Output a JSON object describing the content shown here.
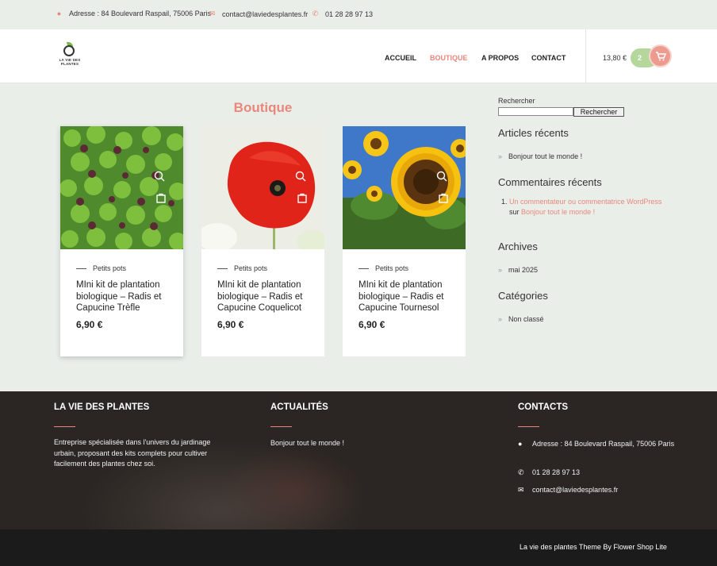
{
  "topbar": {
    "address": "Adresse : 84 Boulevard Raspail, 75006 Paris",
    "email": "contact@laviedesplantes.fr",
    "phone": "01 28 28 97 13",
    "icons": [
      "map-marker-icon",
      "envelope-icon",
      "phone-icon"
    ]
  },
  "logo": {
    "line1": "LA VIE DES",
    "line2": "PLANTES"
  },
  "nav": [
    {
      "label": "ACCUEIL",
      "active": false
    },
    {
      "label": "BOUTIQUE",
      "active": true
    },
    {
      "label": "A PROPOS",
      "active": false
    },
    {
      "label": "CONTACT",
      "active": false
    }
  ],
  "cart": {
    "total": "13,80 €",
    "count": "2",
    "icon": "cart-icon"
  },
  "page": {
    "title": "Boutique"
  },
  "products": [
    {
      "category": "Petits pots",
      "title": "MIni kit de plantation biologique – Radis et Capucine Trèfle",
      "price": "6,90 €",
      "image": "clover-leaves"
    },
    {
      "category": "Petits pots",
      "title": "MIni kit de plantation biologique – Radis et Capucine Coquelicot",
      "price": "6,90 €",
      "image": "red-poppy"
    },
    {
      "category": "Petits pots",
      "title": "MIni kit de plantation biologique – Radis et Capucine Tournesol",
      "price": "6,90 €",
      "image": "sunflower"
    }
  ],
  "sidebar": {
    "search_label": "Rechercher",
    "search_value": "",
    "search_button": "Rechercher",
    "recent_posts_title": "Articles récents",
    "recent_posts": [
      "Bonjour tout le monde !"
    ],
    "recent_comments_title": "Commentaires récents",
    "comment_author": "Un commentateur ou commentatrice WordPress",
    "comment_on": "sur",
    "comment_post": "Bonjour tout le monde !",
    "archives_title": "Archives",
    "archives": [
      "mai 2025"
    ],
    "categories_title": "Catégories",
    "categories": [
      "Non classé"
    ]
  },
  "footer": {
    "col1_title": "LA VIE DES PLANTES",
    "col1_text": "Entreprise spécialisée dans l'univers du jardinage urbain, proposant des kits complets pour cultiver facilement des plantes chez soi.",
    "col2_title": "ACTUALITÉS",
    "col2_post": "Bonjour tout le monde !",
    "col3_title": "CONTACTS",
    "address": "Adresse : 84 Boulevard Raspail, 75006 Paris",
    "phone": "01 28 28 97 13",
    "email": "contact@laviedesplantes.fr",
    "credit": "La vie des plantes Theme By Flower Shop Lite"
  },
  "colors": {
    "accent": "#e9877b",
    "cart_pill": "#b5d79b",
    "page_bg": "#e9eee9",
    "footer_bg": "#2b2623"
  }
}
